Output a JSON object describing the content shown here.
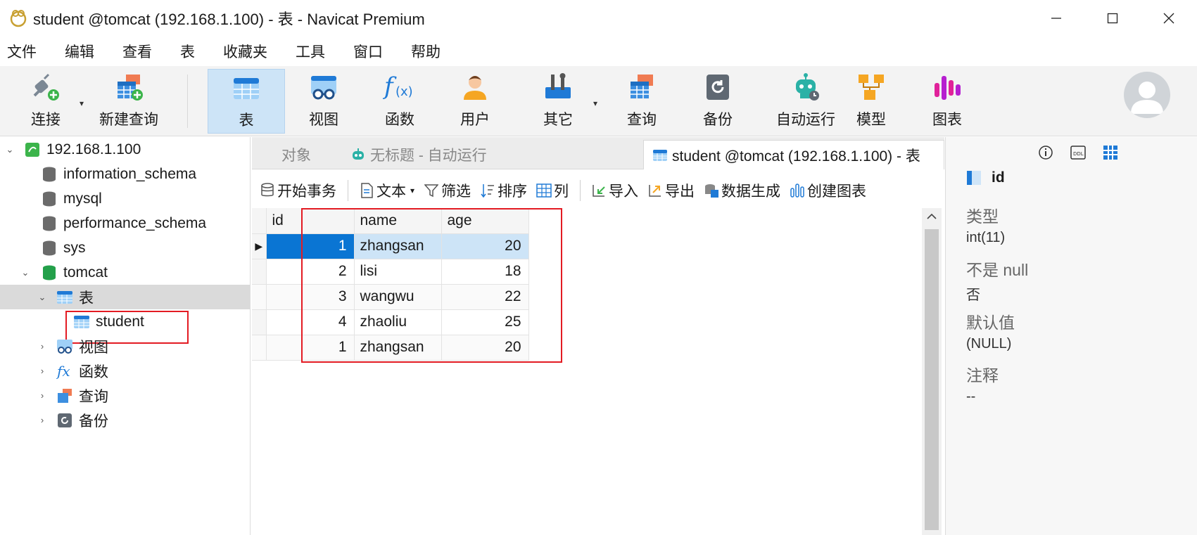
{
  "window": {
    "title": "student @tomcat (192.168.1.100) - 表 - Navicat Premium"
  },
  "menu": [
    "文件",
    "编辑",
    "查看",
    "表",
    "收藏夹",
    "工具",
    "窗口",
    "帮助"
  ],
  "toolbar": {
    "connect": "连接",
    "new_query": "新建查询",
    "table": "表",
    "view": "视图",
    "function": "函数",
    "user": "用户",
    "other": "其它",
    "query": "查询",
    "backup": "备份",
    "automation": "自动运行",
    "model": "模型",
    "chart": "图表"
  },
  "nav": {
    "server": "192.168.1.100",
    "databases": [
      "information_schema",
      "mysql",
      "performance_schema",
      "sys",
      "tomcat"
    ],
    "tables_group": "表",
    "table_student": "student",
    "views_group": "视图",
    "functions_group": "函数",
    "queries_group": "查询",
    "backups_group": "备份"
  },
  "tabs": {
    "objects": "对象",
    "untitled": "无标题 - 自动运行",
    "active": "student @tomcat (192.168.1.100) - 表"
  },
  "actions": {
    "begin_tx": "开始事务",
    "text": "文本",
    "filter": "筛选",
    "sort": "排序",
    "columns": "列",
    "import": "导入",
    "export": "导出",
    "data_gen": "数据生成",
    "create_chart": "创建图表"
  },
  "grid": {
    "columns": [
      "id",
      "name",
      "age"
    ],
    "rows": [
      {
        "id": "1",
        "name": "zhangsan",
        "age": "20"
      },
      {
        "id": "2",
        "name": "lisi",
        "age": "18"
      },
      {
        "id": "3",
        "name": "wangwu",
        "age": "22"
      },
      {
        "id": "4",
        "name": "zhaoliu",
        "age": "25"
      },
      {
        "id": "1",
        "name": "zhangsan",
        "age": "20"
      }
    ]
  },
  "properties": {
    "field_name": "id",
    "type_label": "类型",
    "type_value": "int(11)",
    "not_null_label": "不是 null",
    "not_null_value": "否",
    "default_label": "默认值",
    "default_value": "(NULL)",
    "comment_label": "注释",
    "comment_value": "--"
  },
  "colors": {
    "accent": "#0a75d3",
    "selection": "#cde4f7",
    "highlight_box": "#e31b23"
  }
}
